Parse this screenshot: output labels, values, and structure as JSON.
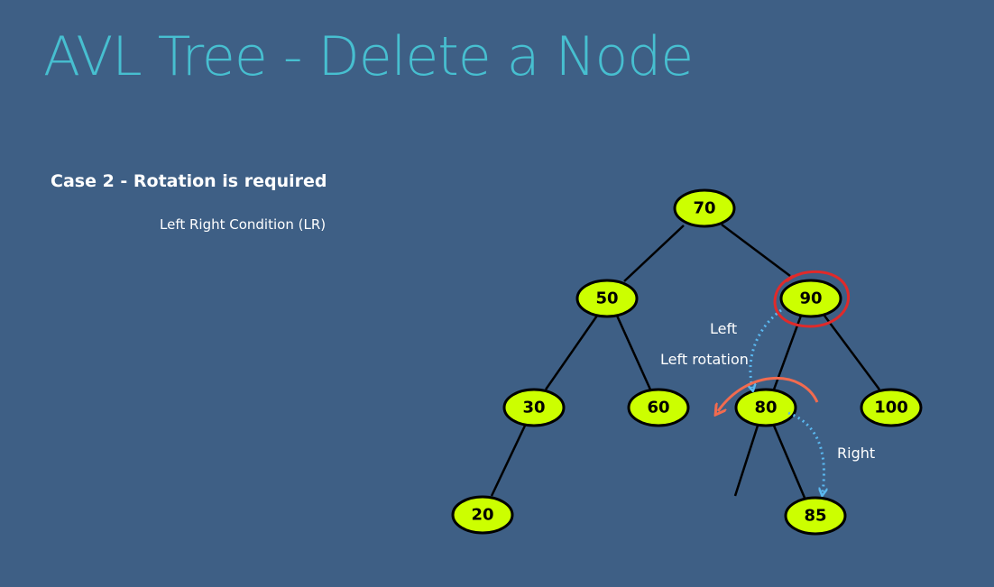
{
  "slide": {
    "title": "AVL Tree - Delete a Node",
    "case_heading": "Case 2 - Rotation is required",
    "case_subheading": "Left Right Condition (LR)"
  },
  "tree": {
    "nodes": [
      {
        "id": "n70",
        "label": "70"
      },
      {
        "id": "n50",
        "label": "50"
      },
      {
        "id": "n90",
        "label": "90",
        "highlighted": true
      },
      {
        "id": "n30",
        "label": "30"
      },
      {
        "id": "n60",
        "label": "60"
      },
      {
        "id": "n80",
        "label": "80"
      },
      {
        "id": "n100",
        "label": "100"
      },
      {
        "id": "n20",
        "label": "20"
      },
      {
        "id": "n85",
        "label": "85"
      }
    ],
    "edges": [
      {
        "from": "n70",
        "to": "n50"
      },
      {
        "from": "n70",
        "to": "n90"
      },
      {
        "from": "n50",
        "to": "n30"
      },
      {
        "from": "n50",
        "to": "n60"
      },
      {
        "from": "n90",
        "to": "n80"
      },
      {
        "from": "n90",
        "to": "n100"
      },
      {
        "from": "n30",
        "to": "n20"
      },
      {
        "from": "n80",
        "to": "n85"
      },
      {
        "from": "n80",
        "to": "stub"
      }
    ],
    "annotations": {
      "left": "Left",
      "left_rotation": "Left rotation",
      "right": "Right"
    }
  },
  "colors": {
    "background": "#3e5f85",
    "title": "#47bfd0",
    "node_fill": "#ccff00",
    "highlight_ring": "#e02a2a",
    "rotation_arrow": "#f26b4f",
    "path_arrow": "#5ab8f0"
  }
}
